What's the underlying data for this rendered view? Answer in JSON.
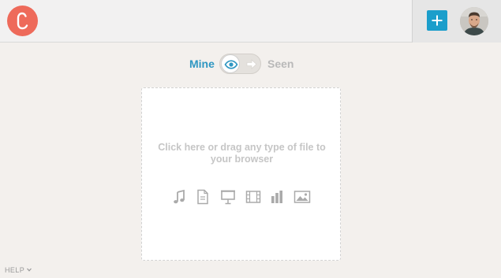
{
  "header": {
    "logo_icon": "brand-c-logo-icon",
    "add_button_icon": "plus-icon",
    "avatar_icon": "user-avatar"
  },
  "toggle": {
    "left_label": "Mine",
    "right_label": "Seen",
    "knob_icon": "eye-icon",
    "arrow_icon": "arrow-right-icon",
    "selected": "Mine"
  },
  "dropzone": {
    "text": "Click here or drag any type of file to your browser",
    "file_type_icons": [
      "music-icon",
      "document-icon",
      "presentation-icon",
      "video-icon",
      "chart-icon",
      "image-icon"
    ]
  },
  "footer": {
    "help_label": "HELP"
  },
  "colors": {
    "brand": "#ee6a5a",
    "accent": "#1b9ecb",
    "background": "#f3f0ed"
  }
}
